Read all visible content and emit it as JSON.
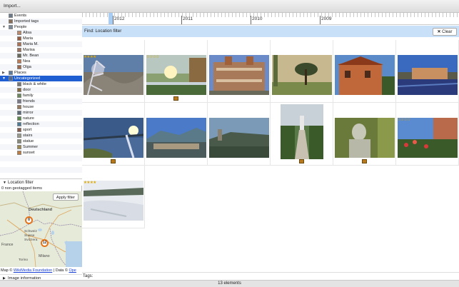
{
  "toolbar": {
    "import_label": "Import..."
  },
  "tree": [
    {
      "label": "Events",
      "thumb": "#6a7a8c"
    },
    {
      "label": "Imported tags",
      "thumb": "#8c6d55"
    },
    {
      "label": "People",
      "arrow": "▼",
      "thumb": "#7a8a9a"
    },
    {
      "label": "Alisa",
      "thumb": "#c08a6a"
    },
    {
      "label": "Maria",
      "thumb": "#9a5c3c"
    },
    {
      "label": "Maria M.",
      "thumb": "#b07050"
    },
    {
      "label": "Marisa",
      "thumb": "#a0705a"
    },
    {
      "label": "Mr. Bean",
      "thumb": "#6a6a5a"
    },
    {
      "label": "Nea",
      "thumb": "#c47a50"
    },
    {
      "label": "Olga",
      "thumb": "#a06848"
    },
    {
      "label": "Places",
      "arrow": "▶",
      "thumb": "#5a7aa0"
    },
    {
      "label": "Uncategorized",
      "arrow": "▼",
      "thumb": "#4a6a9a",
      "selected": true
    },
    {
      "label": "black & white",
      "thumb": "#777777"
    },
    {
      "label": "door",
      "thumb": "#8a6a3a"
    },
    {
      "label": "family",
      "thumb": "#6a8a5a"
    },
    {
      "label": "friends",
      "thumb": "#7a7a8a"
    },
    {
      "label": "house",
      "thumb": "#9a7a5a"
    },
    {
      "label": "mirror",
      "thumb": "#5a6a7a"
    },
    {
      "label": "nature",
      "thumb": "#5a8a4a"
    },
    {
      "label": "reflection",
      "thumb": "#4a7a9a"
    },
    {
      "label": "sport",
      "thumb": "#8a5a4a"
    },
    {
      "label": "stairs",
      "thumb": "#9a9a8a"
    },
    {
      "label": "statue",
      "thumb": "#8a8a7a"
    },
    {
      "label": "Summer",
      "thumb": "#a08a4a"
    },
    {
      "label": "sunset",
      "thumb": "#c07a3a"
    }
  ],
  "location": {
    "header": "Location filter",
    "non_geotagged": "0 non geotagged items",
    "apply_label": "Apply filter",
    "markers": [
      "8",
      "12"
    ],
    "map_labels": [
      "Deutschland",
      "Schweiz",
      "Suisse",
      "Svizzera",
      "France",
      "Milano",
      "Torino"
    ],
    "attribution_prefix": "Map ©",
    "attribution_link": "WikiMedia Foundation",
    "attribution_mid": "| Data ©",
    "attribution_link2": "Ope"
  },
  "image_info": {
    "label": "Image information"
  },
  "timeline": {
    "years": [
      "2012",
      "2011",
      "2010",
      "2009"
    ]
  },
  "find": {
    "label": "Find:  Location filter",
    "clear_label": "Clear"
  },
  "tags": {
    "label": "Tags:"
  },
  "status": {
    "elements": "13 elements"
  },
  "photos": [
    {
      "name": "photo-snowy-branch",
      "stars": "★★★★",
      "badge": false
    },
    {
      "name": "photo-river-sunset",
      "stars": "☆☆☆☆",
      "badge": true
    },
    {
      "name": "photo-palazzo",
      "stars": "",
      "badge": false
    },
    {
      "name": "photo-umbrella-pine",
      "stars": "",
      "badge": false
    },
    {
      "name": "photo-villa",
      "stars": "",
      "badge": false
    },
    {
      "name": "photo-lake-village",
      "stars": "",
      "badge": false
    },
    {
      "name": "photo-lake-sun",
      "stars": "",
      "badge": true
    },
    {
      "name": "photo-mountain-town",
      "stars": "",
      "badge": false
    },
    {
      "name": "photo-castle-hill",
      "stars": "",
      "badge": false
    },
    {
      "name": "photo-garden-stairs",
      "stars": "",
      "badge": true
    },
    {
      "name": "photo-statue-bust",
      "stars": "",
      "badge": true
    },
    {
      "name": "photo-roses-house",
      "stars": "☆☆☆☆",
      "badge": false
    },
    {
      "name": "photo-snow-field",
      "stars": "★★★★",
      "badge": false
    }
  ]
}
